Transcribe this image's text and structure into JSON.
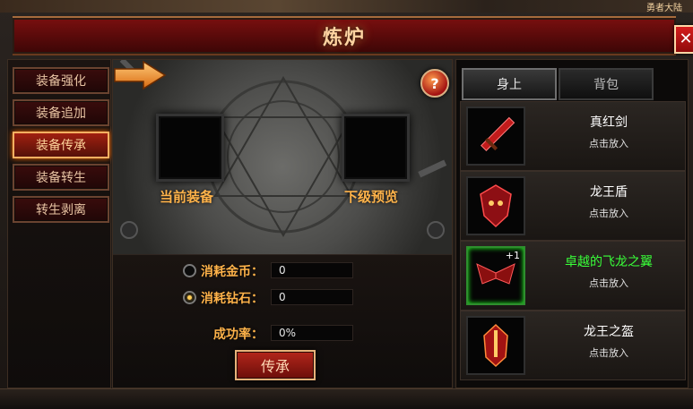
{
  "top": {
    "note": "勇者大陆"
  },
  "window": {
    "title": "炼炉",
    "close_symbol": "✕"
  },
  "nav": [
    {
      "label": "装备强化",
      "active": false
    },
    {
      "label": "装备追加",
      "active": false
    },
    {
      "label": "装备传承",
      "active": true
    },
    {
      "label": "装备转生",
      "active": false
    },
    {
      "label": "转生剥离",
      "active": false
    }
  ],
  "altar": {
    "current_label": "当前装备",
    "preview_label": "下级预览",
    "help_symbol": "?"
  },
  "cost": {
    "gold_label": "消耗金币：",
    "gold_value": "0",
    "diamond_label": "消耗钻石：",
    "diamond_value": "0",
    "selected": "diamond"
  },
  "success": {
    "label": "成功率：",
    "value": "0%"
  },
  "inherit_button": "传承",
  "tabs": [
    {
      "label": "身上",
      "active": true
    },
    {
      "label": "背包",
      "active": false
    }
  ],
  "items": [
    {
      "name": "真红剑",
      "hint": "点击放入",
      "icon": "sword-icon",
      "quality": "normal",
      "badge": ""
    },
    {
      "name": "龙王盾",
      "hint": "点击放入",
      "icon": "dragon-shield-icon",
      "quality": "normal",
      "badge": ""
    },
    {
      "name": "卓越的飞龙之翼",
      "hint": "点击放入",
      "icon": "dragon-wings-icon",
      "quality": "excellent",
      "badge": "+1"
    },
    {
      "name": "龙王之盔",
      "hint": "点击放入",
      "icon": "dragon-helm-icon",
      "quality": "normal",
      "badge": ""
    }
  ],
  "colors": {
    "accent_orange": "#ffb34a",
    "excellent_green": "#39ff39",
    "title_gold": "#ffd3a1"
  }
}
